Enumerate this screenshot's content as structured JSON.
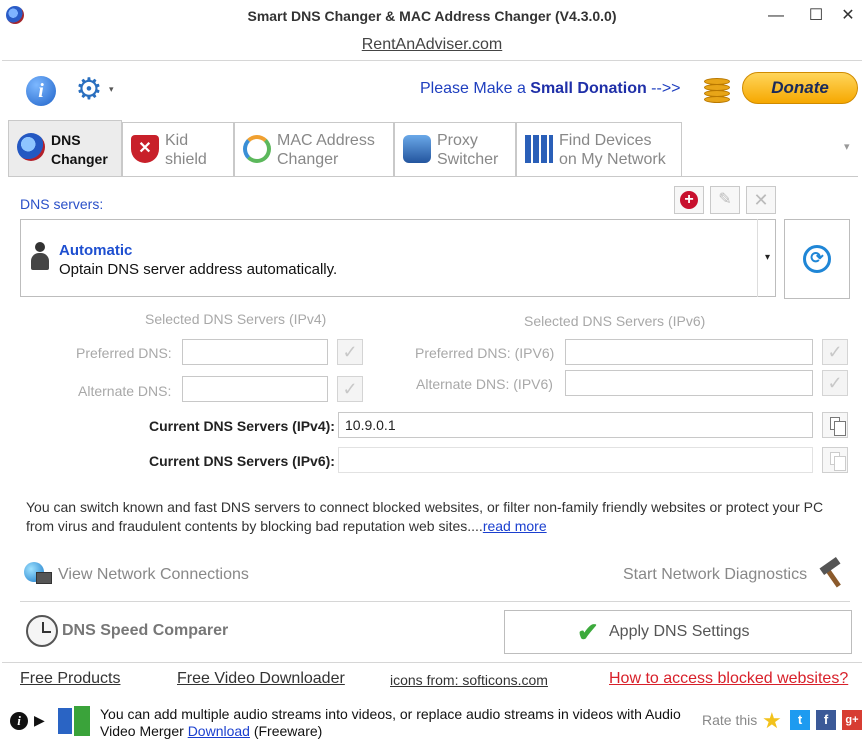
{
  "window": {
    "title": "Smart DNS Changer & MAC Address Changer (V4.3.0.0)",
    "minimize": "—",
    "maximize": "☐",
    "close": "✕"
  },
  "site_link": "RentAnAdviser.com",
  "toolbar": {
    "info_glyph": "i",
    "gear_glyph": "⚙",
    "gear_caret": "▾",
    "donate_prefix": "Please Make a ",
    "donate_emphasis": "Small Donation",
    "donate_suffix": " -->>",
    "donate_button": "Donate"
  },
  "tabs": [
    {
      "label": "DNS\nChanger",
      "icon": "dns-globe-icon",
      "active": true
    },
    {
      "label": "Kid\nshield",
      "icon": "shield-icon",
      "active": false
    },
    {
      "label": "MAC Address\nChanger",
      "icon": "mac-cycle-icon",
      "active": false
    },
    {
      "label": "Proxy\nSwitcher",
      "icon": "proxy-icon",
      "active": false
    },
    {
      "label": "Find Devices\non My Network",
      "icon": "network-devices-icon",
      "active": false
    }
  ],
  "tabs_more": "▾",
  "dns": {
    "servers_label": "DNS servers:",
    "add_glyph": "+",
    "edit_glyph": "✎",
    "delete_glyph": "✕",
    "selected_name": "Automatic",
    "selected_desc": "Optain DNS server address automatically.",
    "dropdown_glyph": "▾",
    "refresh_glyph": "⟳",
    "ipv4_heading": "Selected DNS Servers (IPv4)",
    "ipv6_heading": "Selected DNS Servers (IPv6)",
    "preferred_label": "Preferred DNS:",
    "alternate_label": "Alternate DNS:",
    "preferred_v6_label": "Preferred DNS: (IPV6)",
    "alternate_v6_label": "Alternate DNS: (IPV6)",
    "preferred_value": "",
    "alternate_value": "",
    "preferred_v6_value": "",
    "alternate_v6_value": "",
    "check_glyph": "✓",
    "current_v4_label": "Current DNS Servers (IPv4):",
    "current_v4_value": "10.9.0.1",
    "current_v6_label": "Current DNS Servers (IPv6):",
    "current_v6_value": ""
  },
  "description": {
    "text": "You can switch known and fast DNS servers to connect blocked websites, or filter non-family friendly websites or protect your PC from virus and fraudulent contents by blocking bad reputation web sites....",
    "link": "read more"
  },
  "actions": {
    "view_connections": "View Network Connections",
    "start_diagnostics": "Start Network Diagnostics",
    "speed_comparer": "DNS Speed Comparer",
    "apply_check": "✔",
    "apply": "Apply DNS Settings"
  },
  "footer_links": {
    "free_products": "Free Products",
    "video_downloader": "Free Video Downloader",
    "icons_credit": "icons from: softicons.com",
    "blocked_sites": "How to access blocked websites?"
  },
  "bottom": {
    "info_glyph": "i",
    "play_glyph": "▶",
    "promo_text": "You can add multiple audio streams into videos, or replace audio streams in videos with Audio Video Merger ",
    "promo_link": "Download",
    "promo_suffix": " (Freeware)",
    "rate_label": "Rate this",
    "star_glyph": "★",
    "twitter_glyph": "t",
    "facebook_glyph": "f",
    "gplus_glyph": "g+"
  },
  "colors": {
    "accent_blue": "#1e4fd0",
    "link_red": "#d8202a",
    "donate_gold": "#f6a800",
    "apply_green": "#3daa3d"
  }
}
